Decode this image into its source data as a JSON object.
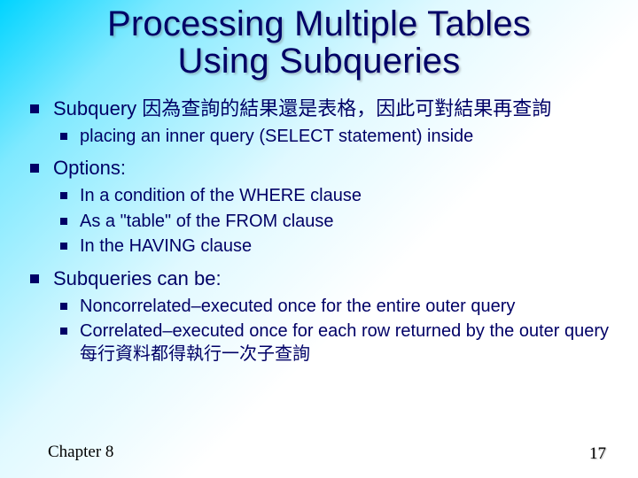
{
  "title_line1": "Processing Multiple Tables",
  "title_line2": "Using Subqueries",
  "b1": {
    "lead": "Subquery",
    "cjk": " 因為查詢的結果還是表格，因此可對結果再查詢",
    "sub1": "placing an inner query (SELECT statement) inside"
  },
  "b2": {
    "lead": "Options:",
    "sub1": "In a condition of the WHERE clause",
    "sub2": "As a \"table\" of the FROM clause",
    "sub3": "In the HAVING clause"
  },
  "b3": {
    "lead": "Subqueries can be:",
    "sub1": "Noncorrelated–executed once for the entire outer query",
    "sub2a": "Correlated–executed once for each row returned by the outer query ",
    "sub2b": "每行資料都得執行一次子查詢"
  },
  "footer": {
    "left": "Chapter 8",
    "right": "17"
  }
}
